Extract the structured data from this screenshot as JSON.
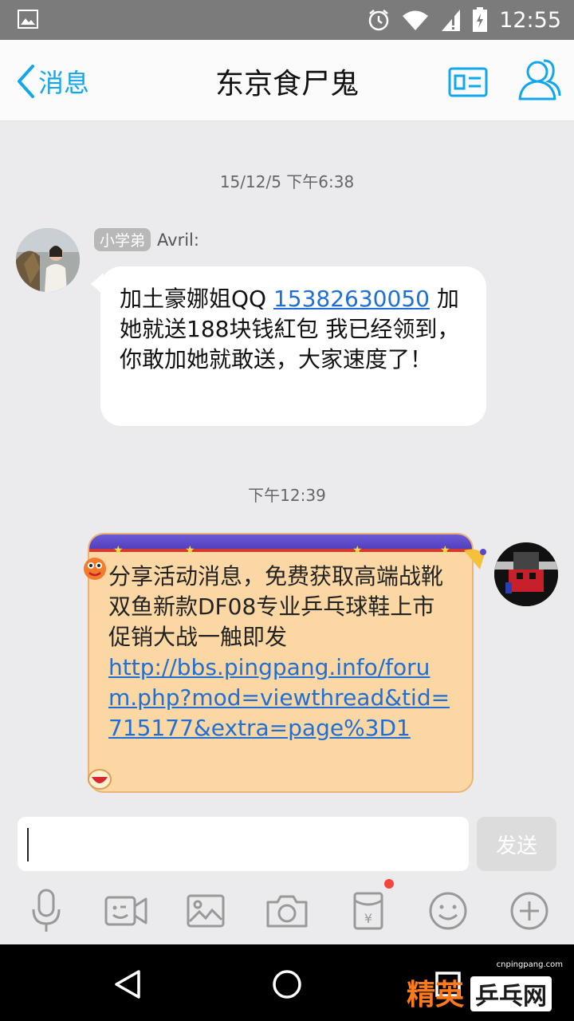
{
  "status_bar": {
    "time": "12:55",
    "icons": [
      "image-icon",
      "alarm-icon",
      "wifi-icon",
      "signal-icon",
      "battery-icon"
    ]
  },
  "header": {
    "back_label": "消息",
    "title": "东京食尸鬼",
    "icons": [
      "profile-card-icon",
      "group-members-icon"
    ],
    "accent_color": "#12a7ea"
  },
  "chat": {
    "messages": [
      {
        "timestamp": "15/12/5 下午6:38",
        "sender_badge": "小学弟",
        "sender_name": "Avril:",
        "text_before_link": "加土豪娜姐QQ ",
        "link": "15382630050",
        "text_after_link": "加她就送188块钱紅包 我已经领到，你敢加她就敢送，大家速度了！"
      },
      {
        "timestamp": "下午12:39",
        "text": "分享活动消息，免费获取高端战靴　双鱼新款DF08专业乒乓球鞋上市 促销大战一触即发",
        "url": "http://bbs.pingpang.info/forum.php?mod=viewthread&tid=715177&extra=page%3D1"
      }
    ]
  },
  "composer": {
    "input_value": "",
    "send_label": "发送",
    "tools": [
      "microphone-icon",
      "video-icon",
      "image-icon",
      "camera-icon",
      "red-packet-icon",
      "emoji-icon",
      "plus-icon"
    ]
  },
  "navigation": {
    "buttons": [
      "back-triangle-icon",
      "home-circle-icon",
      "recents-square-icon"
    ]
  },
  "watermark": {
    "url": "cnpingpang.com",
    "text_a": "精英",
    "text_b": "乒乓网"
  }
}
